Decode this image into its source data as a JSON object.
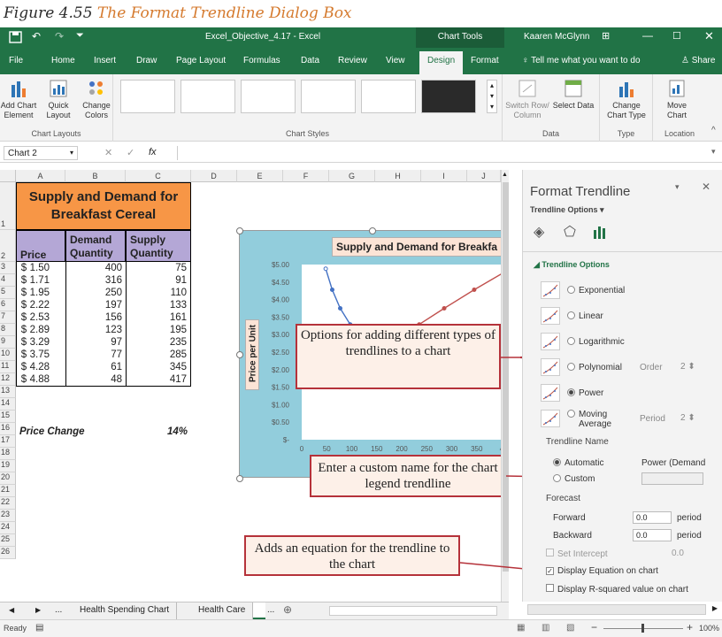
{
  "caption": {
    "prefix": "Figure 4.55",
    "text": "The Format Trendline Dialog Box"
  },
  "titlebar": {
    "filename": "Excel_Objective_4.17 - Excel",
    "context": "Chart Tools",
    "user": "Kaaren McGlynn"
  },
  "ribbon_tabs": [
    "File",
    "Home",
    "Insert",
    "Draw",
    "Page Layout",
    "Formulas",
    "Data",
    "Review",
    "View",
    "Design",
    "Format"
  ],
  "tell_me": "Tell me what you want to do",
  "share": "Share",
  "ribbon": {
    "add_chart_element": "Add Chart Element",
    "quick_layout": "Quick Layout",
    "change_colors": "Change Colors",
    "chart_layouts_label": "Chart Layouts",
    "chart_styles_label": "Chart Styles",
    "switch_row_column": "Switch Row/ Column",
    "select_data": "Select Data",
    "data_label": "Data",
    "change_chart_type": "Change Chart Type",
    "type_label": "Type",
    "move_chart": "Move Chart",
    "location_label": "Location"
  },
  "formula_bar": {
    "name_box": "Chart 2",
    "fx": "fx"
  },
  "columns": [
    "A",
    "B",
    "C",
    "D",
    "E",
    "F",
    "G",
    "H",
    "I",
    "J"
  ],
  "rows": [
    "1",
    "2",
    "3",
    "4",
    "5",
    "6",
    "7",
    "8",
    "9",
    "10",
    "11",
    "12",
    "13",
    "14",
    "15",
    "16",
    "17",
    "18",
    "19",
    "20",
    "21",
    "22",
    "23",
    "24",
    "25",
    "26"
  ],
  "table": {
    "title_line1": "Supply and Demand for",
    "title_line2": "Breakfast Cereal",
    "headers": [
      "Price",
      "Demand Quantity",
      "Supply Quantity"
    ],
    "rows": [
      {
        "currency": "$",
        "price": "1.50",
        "demand": "400",
        "supply": "75"
      },
      {
        "currency": "$",
        "price": "1.71",
        "demand": "316",
        "supply": "91"
      },
      {
        "currency": "$",
        "price": "1.95",
        "demand": "250",
        "supply": "110"
      },
      {
        "currency": "$",
        "price": "2.22",
        "demand": "197",
        "supply": "133"
      },
      {
        "currency": "$",
        "price": "2.53",
        "demand": "156",
        "supply": "161"
      },
      {
        "currency": "$",
        "price": "2.89",
        "demand": "123",
        "supply": "195"
      },
      {
        "currency": "$",
        "price": "3.29",
        "demand": "97",
        "supply": "235"
      },
      {
        "currency": "$",
        "price": "3.75",
        "demand": "77",
        "supply": "285"
      },
      {
        "currency": "$",
        "price": "4.28",
        "demand": "61",
        "supply": "345"
      },
      {
        "currency": "$",
        "price": "4.88",
        "demand": "48",
        "supply": "417"
      }
    ],
    "price_change_label": "Price Change",
    "price_change_value": "14%"
  },
  "chart_data": {
    "type": "scatter",
    "title": "Supply and Demand for Breakfa",
    "ylabel": "Price per Unit",
    "y_ticks": [
      "$5.00",
      "$4.50",
      "$4.00",
      "$3.50",
      "$3.00",
      "$2.50",
      "$2.00",
      "$1.50",
      "$1.00",
      "$0.50",
      "$-"
    ],
    "x_ticks": [
      "0",
      "50",
      "100",
      "150",
      "200",
      "250",
      "300",
      "350",
      "4"
    ],
    "xlim": [
      0,
      400
    ],
    "ylim": [
      0,
      5
    ],
    "series": [
      {
        "color": "#4472c4",
        "x": [
          400,
          316,
          250,
          197,
          156,
          123,
          97,
          77,
          61,
          48
        ],
        "y": [
          1.5,
          1.71,
          1.95,
          2.22,
          2.53,
          2.89,
          3.29,
          3.75,
          4.28,
          4.88
        ]
      },
      {
        "color": "#c0504d",
        "x": [
          75,
          91,
          110,
          133,
          161,
          195,
          235,
          285,
          345,
          417
        ],
        "y": [
          1.5,
          1.71,
          1.95,
          2.22,
          2.53,
          2.89,
          3.29,
          3.75,
          4.28,
          4.88
        ]
      }
    ]
  },
  "callouts": {
    "options": "Options for adding different types of trendlines to a chart",
    "custom_name": "Enter a custom name for the chart legend trendline",
    "equation": "Adds an equation for the trendline to the chart"
  },
  "pane": {
    "title": "Format Trendline",
    "subtitle": "Trendline Options",
    "section": "Trendline Options",
    "types": [
      {
        "label": "Exponential",
        "selected": false
      },
      {
        "label": "Linear",
        "selected": false
      },
      {
        "label": "Logarithmic",
        "selected": false
      },
      {
        "label": "Polynomial",
        "selected": false
      },
      {
        "label": "Power",
        "selected": true
      },
      {
        "label": "Moving Average",
        "selected": false
      }
    ],
    "order_label": "Order",
    "order_value": "2",
    "period_label": "Period",
    "period_value": "2",
    "trendline_name_label": "Trendline Name",
    "automatic_label": "Automatic",
    "automatic_value": "Power (Demand",
    "custom_label": "Custom",
    "forecast_label": "Forecast",
    "forward_label": "Forward",
    "forward_value": "0.0",
    "backward_label": "Backward",
    "backward_value": "0.0",
    "period_unit": "period",
    "set_intercept_label": "Set Intercept",
    "set_intercept_value": "0.0",
    "display_equation_label": "Display Equation on chart",
    "display_equation_checked": true,
    "display_r2_label": "Display R-squared value on chart",
    "display_r2_checked": false
  },
  "sheet_tabs": [
    "...",
    "Health Spending Chart",
    "Health Care",
    "..."
  ],
  "status": {
    "ready": "Ready",
    "zoom": "100%"
  },
  "colors": {
    "excel_green": "#217346",
    "table_title_bg": "#f79646",
    "table_header_bg": "#b4a7d6",
    "chart_bg": "#92cddc",
    "callout_border": "#b5323a",
    "callout_bg": "#fdf0e8"
  }
}
